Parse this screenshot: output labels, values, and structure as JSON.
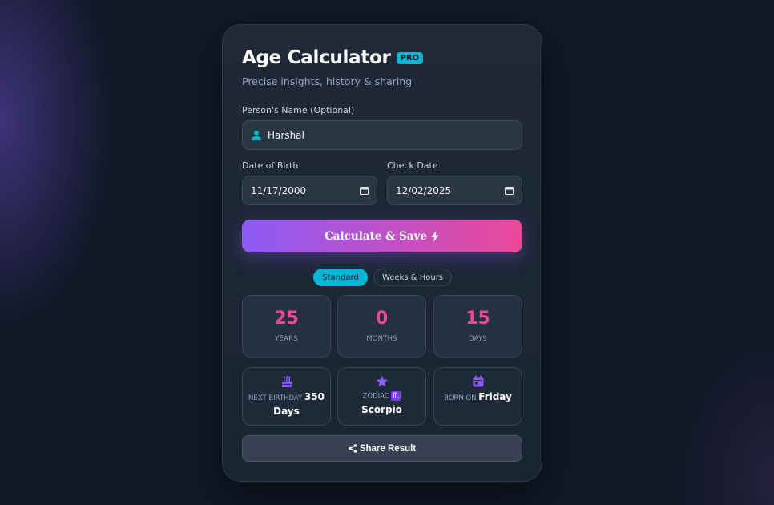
{
  "app": {
    "title": "Age Calculator",
    "badge": "PRO",
    "subtitle": "Precise insights, history & sharing"
  },
  "form": {
    "name_label": "Person's Name (Optional)",
    "name_value": "Harshal",
    "dob_label": "Date of Birth",
    "dob_value": "11/17/2000",
    "check_label": "Check Date",
    "check_value": "12/02/2025",
    "calculate_label": "Calculate & Save"
  },
  "tabs": [
    {
      "label": "Standard",
      "active": true
    },
    {
      "label": "Weeks & Hours",
      "active": false
    }
  ],
  "stats": [
    {
      "value": "25",
      "unit": "YEARS"
    },
    {
      "value": "0",
      "unit": "MONTHS"
    },
    {
      "value": "15",
      "unit": "DAYS"
    }
  ],
  "info": {
    "next_birthday": {
      "label": "NEXT BIRTHDAY",
      "value_num": "350",
      "value_unit": "Days",
      "icon": "birthday-cake-icon"
    },
    "zodiac": {
      "label": "ZODIAC",
      "symbol": "♏",
      "value": "Scorpio",
      "icon": "star-icon"
    },
    "born_on": {
      "label": "BORN ON",
      "value": "Friday",
      "icon": "calendar-icon"
    }
  },
  "share_label": "Share Result",
  "colors": {
    "accent_cyan": "#06b6d4",
    "accent_pink": "#ec4899",
    "accent_purple": "#8b5cf6",
    "background": "#111827",
    "card": "#1f2937"
  }
}
